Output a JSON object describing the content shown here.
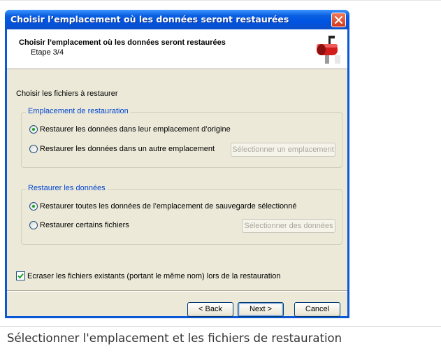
{
  "window": {
    "title": "Choisir l’emplacement où les données seront restaurées"
  },
  "header": {
    "title": "Choisir l’emplacement où les données seront restaurées",
    "step": "Etape 3/4",
    "icon": "mailbox-icon"
  },
  "instruction": "Choisir les fichiers à restaurer",
  "location_group": {
    "legend": "Emplacement de restauration",
    "option_original": "Restaurer les données dans leur emplacement d’origine",
    "option_other": "Restaurer les données dans un autre emplacement",
    "select_location_button": "Sélectionner un emplacement",
    "selected": "original"
  },
  "data_group": {
    "legend": "Restaurer les données",
    "option_all": "Restaurer toutes les données de l’emplacement de sauvegarde sélectionné",
    "option_some": "Restaurer certains fichiers",
    "select_data_button": "Sélectionner des données",
    "selected": "all"
  },
  "overwrite": {
    "label": "Ecraser les fichiers existants (portant le même nom) lors de la restauration",
    "checked": true
  },
  "buttons": {
    "back": "< Back",
    "next": "Next >",
    "cancel": "Cancel"
  },
  "caption": "Sélectionner l'emplacement et les fichiers de restauration"
}
